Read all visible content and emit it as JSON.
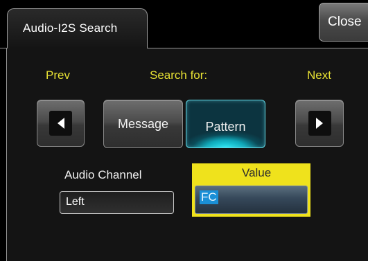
{
  "dialog": {
    "tab_title": "Audio-I2S Search",
    "close_label": "Close"
  },
  "search": {
    "prev_label": "Prev",
    "search_for_label": "Search for:",
    "next_label": "Next",
    "modes": [
      {
        "label": "Message",
        "selected": false
      },
      {
        "label": "Pattern",
        "selected": true
      }
    ]
  },
  "fields": {
    "audio_channel_label": "Audio Channel",
    "audio_channel_value": "Left",
    "value_label": "Value",
    "value_input": "FC"
  },
  "colors": {
    "accent_yellow": "#efe21c",
    "label_yellow": "#e8e234",
    "active_cyan": "#27e4f2"
  },
  "icons": {
    "prev": "triangle-left-icon",
    "next": "triangle-right-icon"
  }
}
